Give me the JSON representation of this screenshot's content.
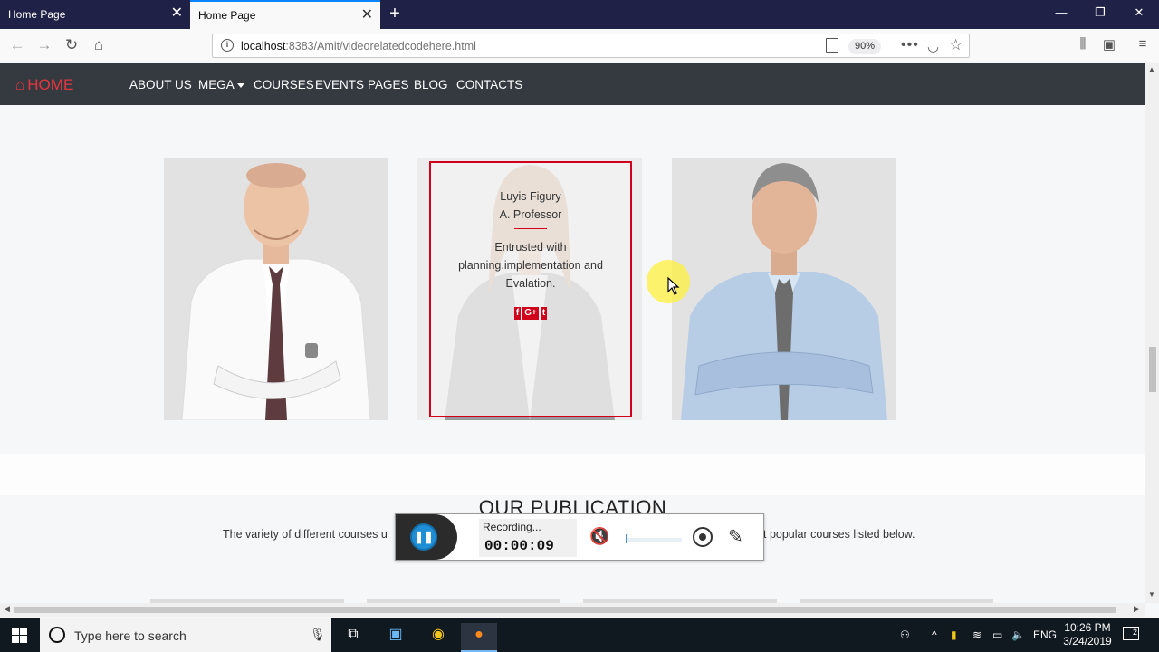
{
  "browser": {
    "tabs": [
      {
        "label": "Home Page",
        "active": false
      },
      {
        "label": "Home Page",
        "active": true
      }
    ],
    "url_host": "localhost",
    "url_rest": ":8383/Amit/videorelatedcodehere.html",
    "zoom": "90%"
  },
  "site": {
    "brand": "HOME",
    "menu": [
      "ABOUT US",
      "MEGA",
      "COURSES",
      "EVENTS",
      "PAGES",
      "BLOG",
      "CONTACTS"
    ]
  },
  "team_card": {
    "name": "Luyis Figury",
    "title": "A. Professor",
    "description": "Entrusted with planning.implementation and Evalation.",
    "socials": [
      "f",
      "G+",
      "t"
    ]
  },
  "publication": {
    "heading": "OUR PUBLICATION",
    "text_left": "The variety of different courses u",
    "text_right": "t popular courses listed below."
  },
  "recorder": {
    "status": "Recording...",
    "time": "00:00:09"
  },
  "taskbar": {
    "search_placeholder": "Type here to search",
    "language": "ENG",
    "time": "10:26 PM",
    "date": "3/24/2019",
    "notifications": "2"
  },
  "colors": {
    "accent_red": "#d0021b",
    "nav_bg": "#343a40",
    "brand_red": "#e7353f"
  }
}
